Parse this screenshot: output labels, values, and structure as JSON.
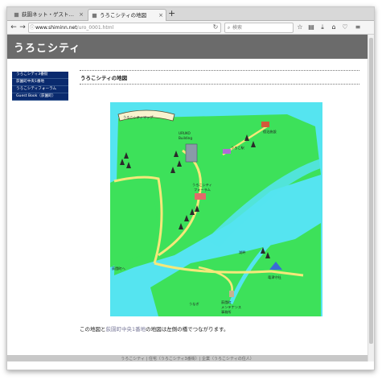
{
  "browser": {
    "tabs": [
      {
        "title": "荻園ネット・ゲスト…",
        "active": false
      },
      {
        "title": "うろこシティの地図",
        "active": true
      }
    ],
    "new_tab_label": "+",
    "url_host": "www.shiminn.net",
    "url_path": "/uro_0001.html",
    "search_placeholder": "検索",
    "info_glyph": "ⓘ"
  },
  "page": {
    "site_title": "うろこシティ",
    "sidebar_items": [
      "うろこシティ3番街",
      "荻園町中央1番地",
      "うろこシティフォーラム",
      "Guest Book（荻園町）"
    ],
    "heading": "うろこシティの地図",
    "caption_before": "この地図と",
    "caption_link": "荻園町中央1番地",
    "caption_after": "の地図は左側の橋でつながります。",
    "footer": "うろこシティ | 住宅（うろこシティ3番街）| 企業（うろこシティの住人）"
  },
  "map": {
    "banner_text": "うろこシティマップ",
    "labels": {
      "building": "URUKO",
      "building2": "Building",
      "forum": "うろこシティ",
      "forum2": "フォーラム",
      "station": "うろこ駅",
      "inn": "宿泊施設",
      "bridge_left": "荻園町へ",
      "lake": "湖畔",
      "shrine": "竜津守社",
      "eel": "うなぎ",
      "maint": "荻園町",
      "maint2": "メンテナンス",
      "maint3": "事務所"
    }
  },
  "colors": {
    "banner": "#6b6b6b",
    "sidebar": "#0a2a6e",
    "land": "#3de15a",
    "water": "#55e4f0",
    "road": "#f5e87a"
  }
}
